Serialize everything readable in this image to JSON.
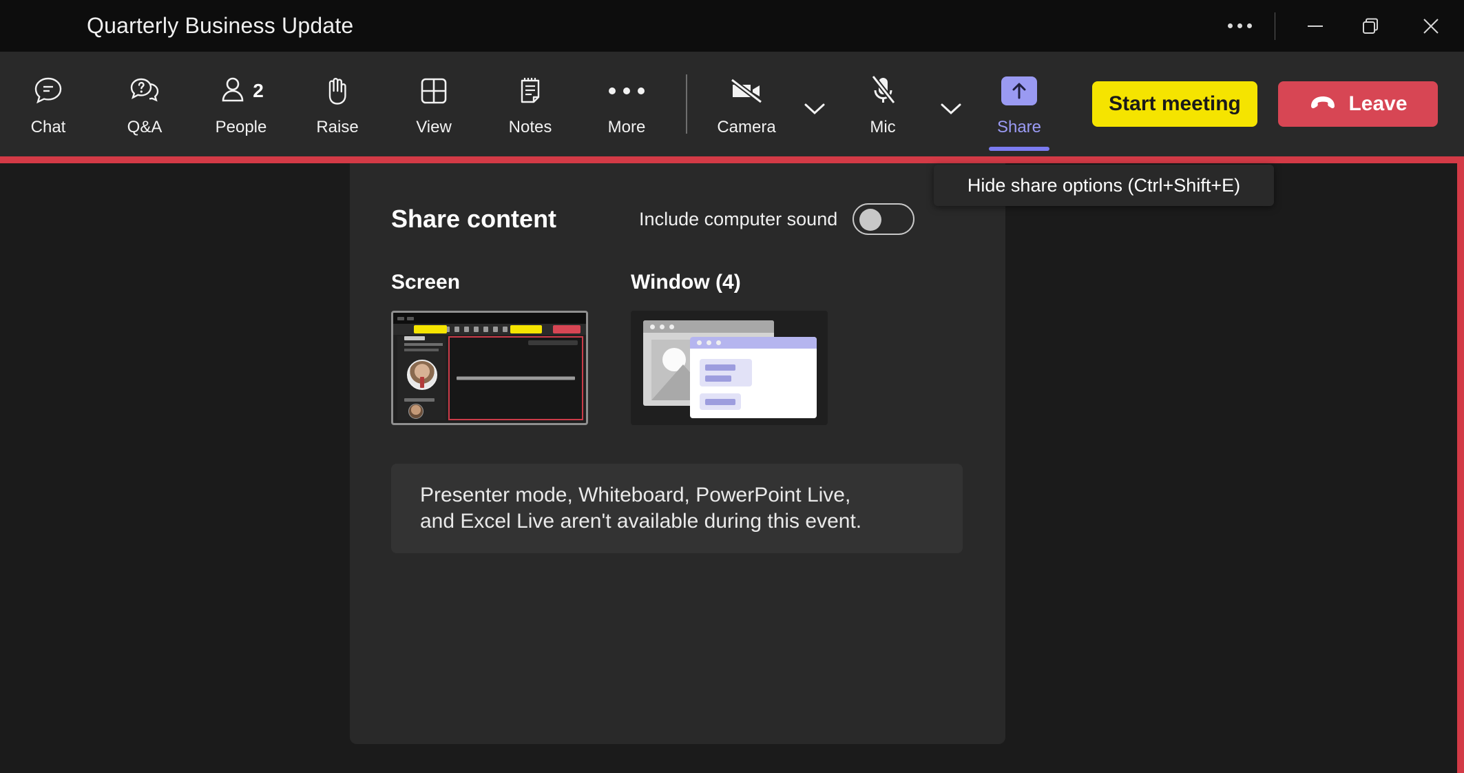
{
  "window": {
    "title": "Quarterly Business Update",
    "controls": [
      {
        "name": "more-options",
        "glyph": "dots"
      },
      {
        "name": "minimize",
        "glyph": "minimize"
      },
      {
        "name": "restore",
        "glyph": "restore"
      },
      {
        "name": "close",
        "glyph": "close"
      }
    ]
  },
  "toolbar": {
    "items": [
      {
        "label": "Chat",
        "icon": "chat-icon"
      },
      {
        "label": "Q&A",
        "icon": "qa-icon"
      },
      {
        "label": "People",
        "icon": "people-icon",
        "badge": "2"
      },
      {
        "label": "Raise",
        "icon": "raise-hand-icon"
      },
      {
        "label": "View",
        "icon": "view-grid-icon"
      },
      {
        "label": "Notes",
        "icon": "notes-icon"
      },
      {
        "label": "More",
        "icon": "more-icon"
      }
    ],
    "media": [
      {
        "label": "Camera",
        "icon": "camera-off-icon",
        "state": "off"
      },
      {
        "label": "Mic",
        "icon": "mic-off-icon",
        "state": "off"
      },
      {
        "label": "Share",
        "icon": "share-up-arrow-icon",
        "state": "active"
      }
    ],
    "start_meeting_label": "Start meeting",
    "leave_label": "Leave"
  },
  "tooltip": {
    "text": "Hide share options (Ctrl+Shift+E)"
  },
  "share_panel": {
    "title": "Share content",
    "include_sound_label": "Include computer sound",
    "include_sound_on": false,
    "sources": [
      {
        "title": "Screen",
        "type": "screen",
        "selected": true
      },
      {
        "title": "Window (4)",
        "type": "window",
        "selected": false
      }
    ],
    "info_line_1": "Presenter mode, Whiteboard, PowerPoint Live,",
    "info_line_2": "and Excel Live aren't available during this event."
  },
  "colors": {
    "accent_purple": "#9a9af2",
    "start_yellow": "#f5e400",
    "leave_red": "#d74654",
    "share_border_red": "#d33a46",
    "panel_bg": "#292929",
    "app_bg": "#1b1b1b"
  }
}
